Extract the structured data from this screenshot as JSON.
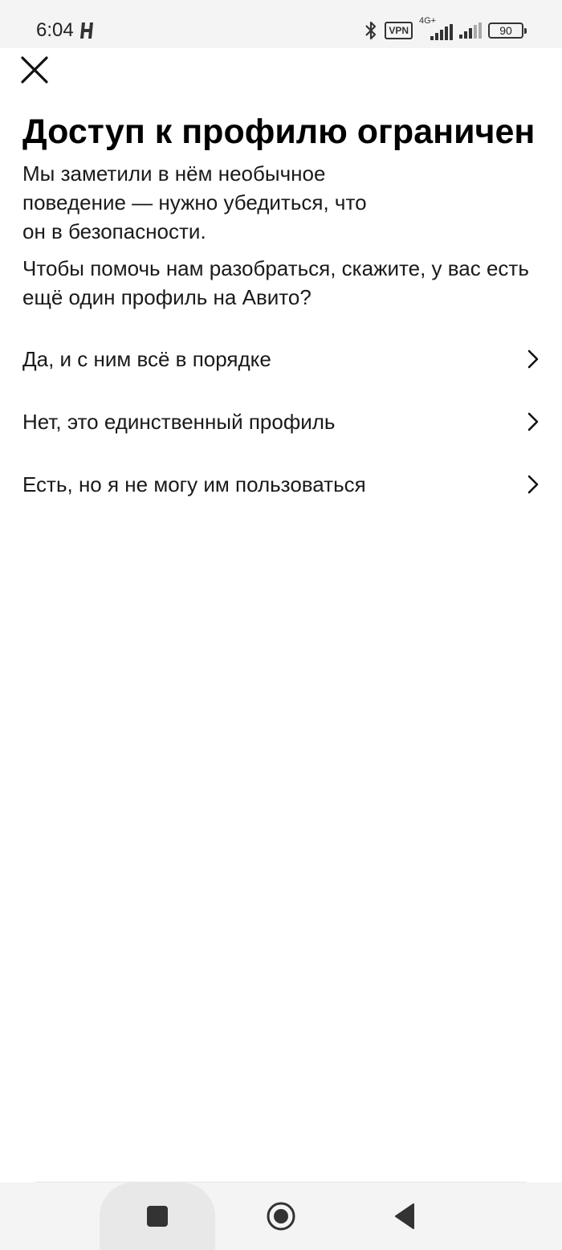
{
  "status_bar": {
    "time": "6:04",
    "vpn": "VPN",
    "network": "4G+",
    "battery": "90",
    "icons": [
      "app-h-icon",
      "bluetooth-icon",
      "signal-icon",
      "signal-icon",
      "battery-icon"
    ]
  },
  "header": {
    "close_icon": "close-icon"
  },
  "main": {
    "title": "Доступ к профилю ограничен",
    "description_1": "Мы заметили в нём необычное поведение — нужно убедиться, что он в безопасности.",
    "description_2": "Чтобы помочь нам разобраться, скажите, у вас есть ещё один профиль на Авито?",
    "options": [
      {
        "label": "Да, и с ним всё в порядке",
        "icon": "chevron-right-icon"
      },
      {
        "label": "Нет, это единственный профиль",
        "icon": "chevron-right-icon"
      },
      {
        "label": "Есть, но я не могу им пользоваться",
        "icon": "chevron-right-icon"
      }
    ]
  },
  "nav_bar": {
    "icons": [
      "recents-square-icon",
      "home-circle-icon",
      "back-triangle-icon"
    ]
  },
  "colors": {
    "text": "#111111",
    "background": "#ffffff",
    "system_bar": "#f4f4f4"
  }
}
